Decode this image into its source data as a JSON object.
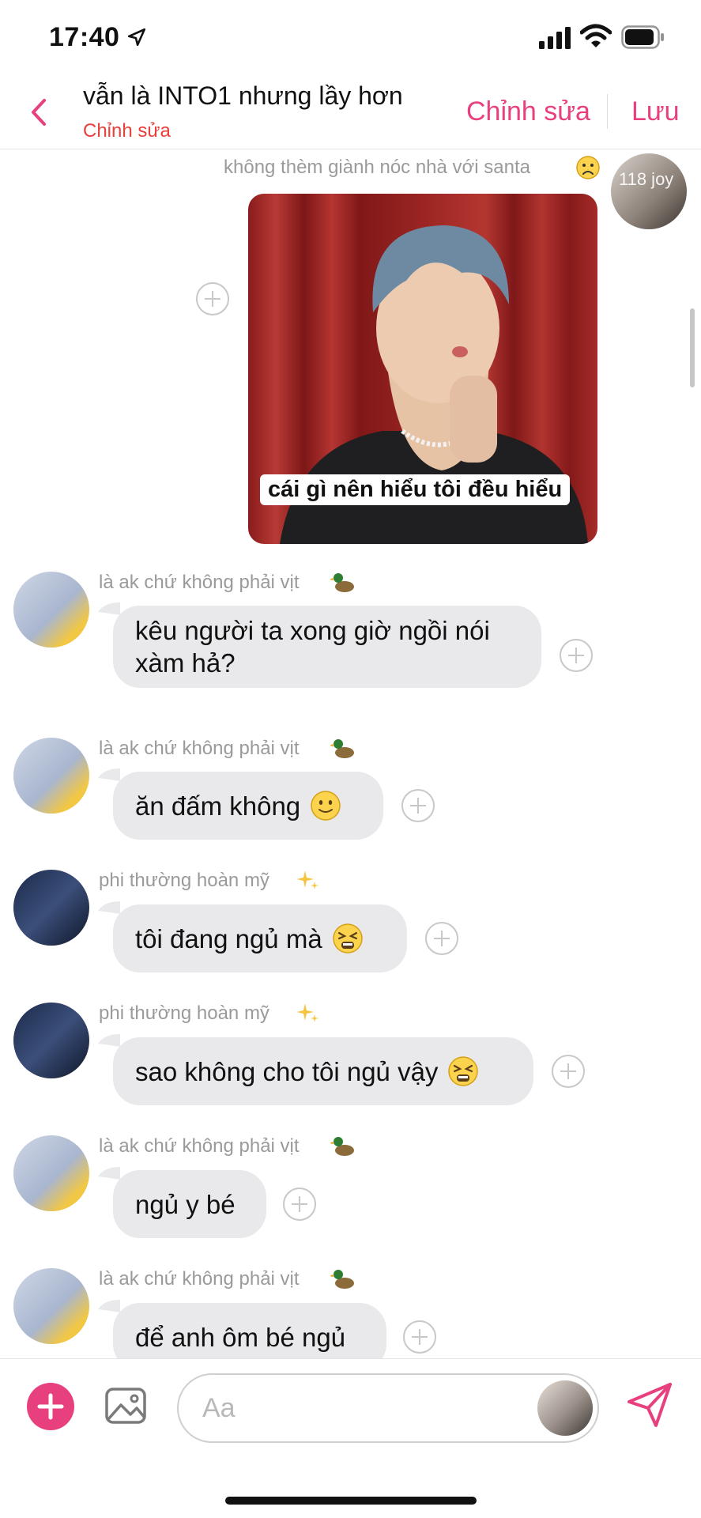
{
  "status_bar": {
    "time": "17:40"
  },
  "header": {
    "title": "vẫn là INTO1 nhưng lầy hơn",
    "subtitle": "Chỉnh sửa",
    "edit_label": "Chỉnh sửa",
    "save_label": "Lưu"
  },
  "messages": {
    "top_sender": "không thèm giành nóc nhà với santa",
    "top_avatar_label": "118 joy",
    "photo_caption": "cái gì nên hiểu tôi đều hiểu",
    "items": [
      {
        "sender": "là ak chứ không phải vịt",
        "text": "kêu người ta xong giờ ngồi nói xàm hả?"
      },
      {
        "sender": "là ak chứ không phải vịt",
        "text": "ăn đấm không"
      },
      {
        "sender": "phi thường hoàn mỹ",
        "text": "tôi đang ngủ mà"
      },
      {
        "sender": "phi thường hoàn mỹ",
        "text": "sao không cho tôi ngủ vậy"
      },
      {
        "sender": "là ak chứ không phải vịt",
        "text": "ngủ y bé"
      },
      {
        "sender": "là ak chứ không phải vịt",
        "text": "để anh ôm bé ngủ"
      }
    ]
  },
  "composer": {
    "placeholder": "Aa"
  },
  "colors": {
    "accent": "#e8407f",
    "subtitle": "#e8403a",
    "bubble": "#e9e9eb"
  }
}
